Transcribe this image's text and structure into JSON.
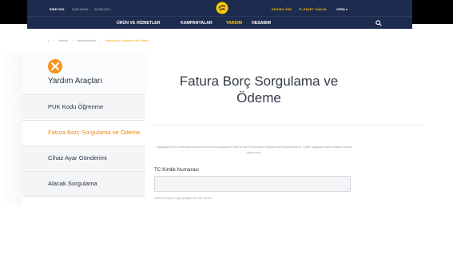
{
  "topnav": {
    "utility": [
      "BİREYSEL",
      "KURUMSAL",
      "WORKCELL",
      "FATURA ÖDE",
      "TL.PAKET YÜKLE",
      "GİRİŞ"
    ],
    "main": [
      "ÜRÜN VE HİZMETLER",
      "KAMPANYALAR",
      "YARDIM",
      "HESABIM"
    ],
    "active_main": "YARDIM",
    "brand_color": "#ffc900",
    "bg_color": "#1d2b4f"
  },
  "breadcrumb": [
    "Yardım",
    "Yardım Araçları",
    "Fatura Borç Sorgulama ve Ödeme"
  ],
  "sidebar": {
    "title": "Yardım Araçları",
    "icon": "tools-icon",
    "items": [
      {
        "label": "PUK Kodu Öğrenme"
      },
      {
        "label": "Fatura Borç Sorgulama ve Ödeme"
      },
      {
        "label": "Cihaz Ayar Gönderimi"
      },
      {
        "label": "Alacak Sorgulama"
      }
    ],
    "active_color": "#ee8a1b"
  },
  "main": {
    "title": "Fatura Borç Sorgulama ve Ödeme",
    "intro": "Aşağıdaki formu doldurarak fatura borcunuzu sorgulayabilir, internet kartı veya banka kartıyla ödeme yapabilirsiniz. Lütfen aşağıdaki formu eksiksiz olarak doldurunuz.",
    "tc_label": "TC Kimlik Numarası",
    "tc_value": "",
    "hint": "Kimlik numaranızı doğru girdiğinizden emin olunuz."
  }
}
